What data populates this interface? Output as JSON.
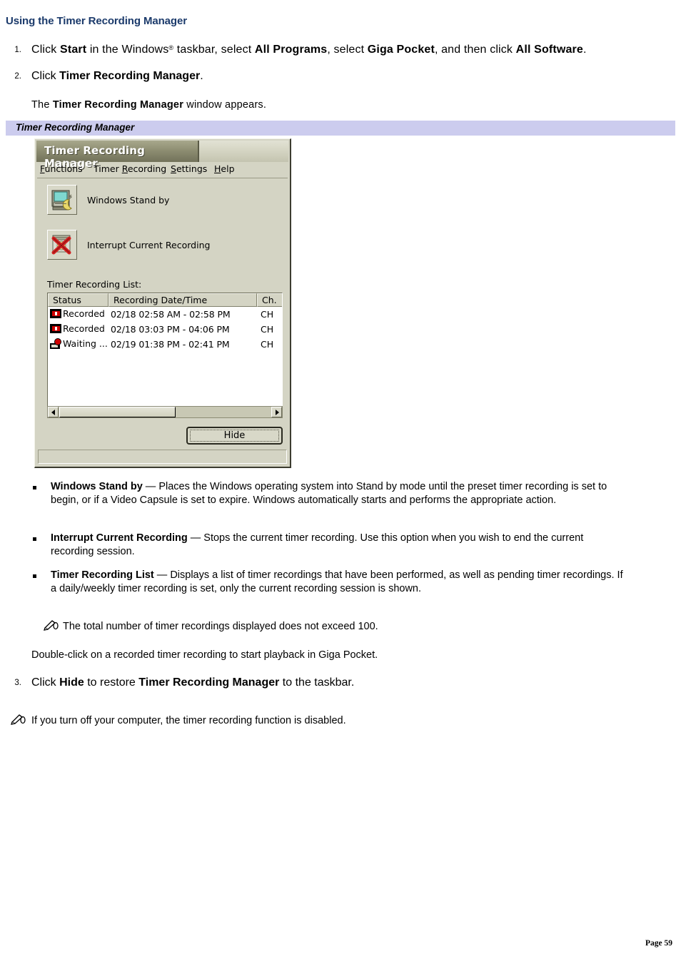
{
  "document": {
    "heading": "Using the Timer Recording Manager",
    "footer": "Page 59"
  },
  "steps": [
    {
      "number": "1.",
      "number_plain": "1",
      "text_html": "Click <b>Start</b> in the Windows<sup class=\"reg\">®</sup> taskbar, select <b>All Programs</b>, select <b>Giga Pocket</b>, and then click <b>All Software</b>."
    },
    {
      "number": "2.",
      "number_plain": "2",
      "text_html": "Click <b>Timer Recording Manager</b>.",
      "sub_html": "The <b>Timer Recording Manager</b> window appears."
    },
    {
      "number": "3.",
      "number_plain": "3",
      "text_html": "Click <b>Hide</b> to restore <b>Timer Recording Manager</b> to the taskbar."
    }
  ],
  "figure": {
    "caption": "Timer Recording Manager",
    "caption_bg": "#ccccee",
    "window": {
      "title": "Timer Recording Manager",
      "menu": [
        {
          "pre": "",
          "accel": "F",
          "post": "unctions"
        },
        {
          "pre": "Timer ",
          "accel": "R",
          "post": "ecording"
        },
        {
          "pre": "",
          "accel": "S",
          "post": "ettings"
        },
        {
          "pre": "",
          "accel": "H",
          "post": "elp"
        }
      ],
      "toolbar": [
        {
          "icon": "standby-monitor-icon",
          "label": "Windows Stand by"
        },
        {
          "icon": "interrupt-recording-icon",
          "label": "Interrupt Current Recording"
        }
      ],
      "list_label": "Timer Recording List:",
      "columns": [
        "Status",
        "Recording Date/Time",
        "Ch."
      ],
      "rows": [
        {
          "icon": "tape-recorded-icon",
          "status": "Recorded",
          "datetime": "02/18 02:58 AM - 02:58 PM",
          "channel": "CH"
        },
        {
          "icon": "tape-recorded-icon",
          "status": "Recorded",
          "datetime": "02/18 03:03 PM - 04:06 PM",
          "channel": "CH"
        },
        {
          "icon": "waiting-icon",
          "status": "Waiting ...",
          "datetime": "02/19 01:38 PM - 02:41 PM",
          "channel": "CH"
        }
      ],
      "hide_button": "Hide"
    }
  },
  "bullets": [
    {
      "term": "Windows Stand by",
      "html": "<b>Windows Stand by</b> — Places the Windows operating system into Stand by mode until the preset timer recording is set to begin, or if a Video Capsule is set to expire. Windows automatically starts and performs the appropriate action."
    },
    {
      "term": "Interrupt Current Recording",
      "html": "<b>Interrupt Current Recording</b> — Stops the current timer recording. Use this option when you wish to end the current recording session."
    },
    {
      "term": "Timer Recording List",
      "html": "<b>Timer Recording List</b> — Displays a list of timer recordings that have been performed, as well as pending timer recordings. If a daily/weekly timer recording is set, only the current recording session is shown."
    }
  ],
  "notes": [
    {
      "icon": "note-pencil-icon",
      "text": "The total number of timer recordings displayed does not exceed 100."
    },
    {
      "icon": "note-pencil-icon",
      "text": "If you turn off your computer, the timer recording function is disabled."
    }
  ],
  "body_text": {
    "double_click": "Double-click on a recorded timer recording to start playback in Giga Pocket."
  }
}
